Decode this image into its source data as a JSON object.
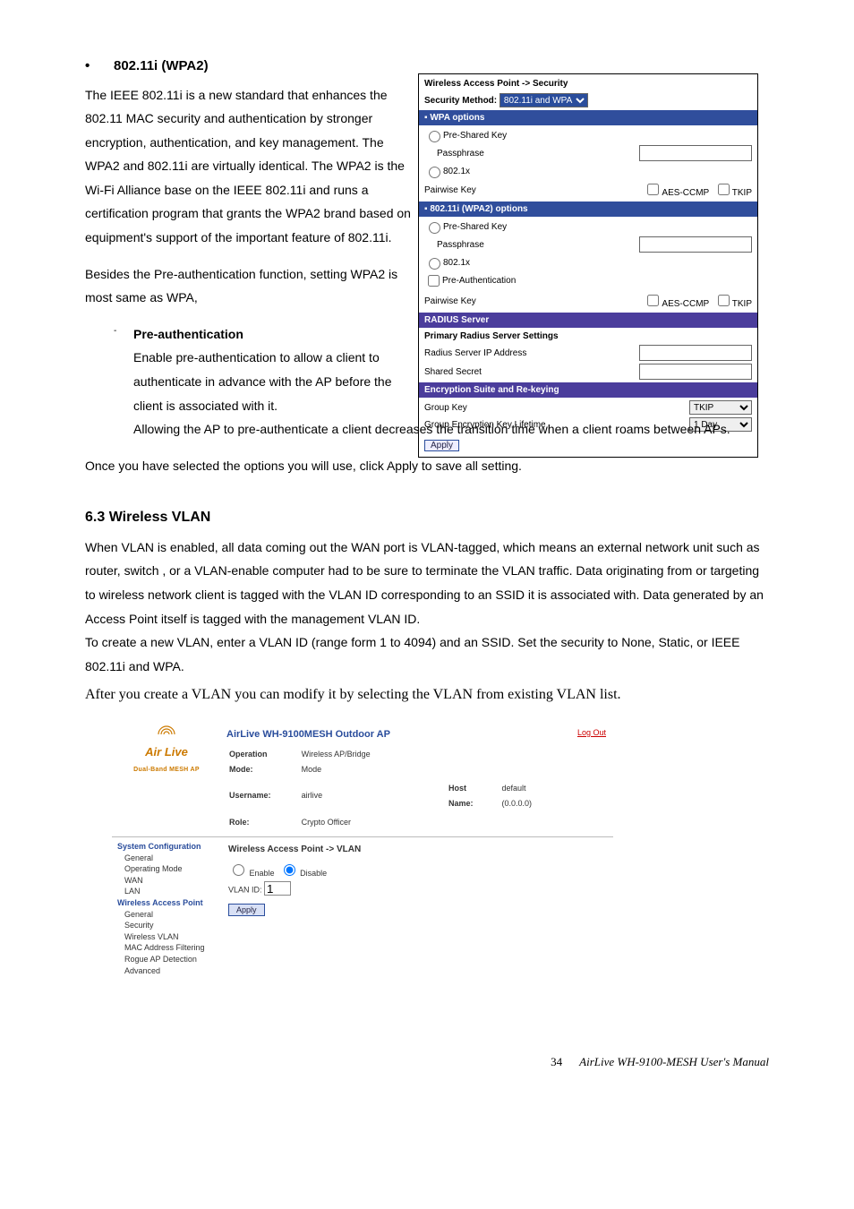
{
  "sec1": {
    "title": "802.11i (WPA2)",
    "p1": "The IEEE 802.11i is a new standard that enhances the 802.11 MAC security and authentication by stronger encryption, authentication, and key management. The WPA2 and 802.11i are virtually identical. The WPA2 is the Wi-Fi Alliance base on the IEEE 802.11i and runs a certification program that grants the WPA2 brand based on equipment's support of the important feature of 802.11i.",
    "p2": "Besides the Pre-authentication function, setting WPA2 is most same as WPA,",
    "sub_title": "Pre-authentication",
    "sub_p1": "Enable pre-authentication to allow a client to authenticate in advance with the AP before the client is associated with it.",
    "sub_p2": "Allowing the AP to pre-authenticate a client decreases the transition time when a client roams between APs.",
    "p3": "Once you have selected the options you will use, click Apply to save all setting."
  },
  "security_panel": {
    "crumb": "Wireless Access Point -> Security",
    "method_label": "Security Method:",
    "method_value": "802.11i and WPA",
    "wpa_hdr": "WPA options",
    "wpa2_hdr": "802.11i (WPA2) options",
    "psk": "Pre-Shared Key",
    "pass": "Passphrase",
    "dot1x": "802.1x",
    "preauth": "Pre-Authentication",
    "pairwise": "Pairwise Key",
    "aes": "AES-CCMP",
    "tkip": "TKIP",
    "radius_hdr": "RADIUS Server",
    "radius_primary": "Primary Radius Server Settings",
    "radius_ip": "Radius Server IP Address",
    "radius_secret": "Shared Secret",
    "enc_hdr": "Encryption Suite and Re-keying",
    "group_key": "Group Key",
    "group_key_val": "TKIP",
    "lifetime": "Group Encryption Key Lifetime",
    "lifetime_val": "1 Day",
    "apply": "Apply"
  },
  "sec2": {
    "heading": "6.3 Wireless VLAN",
    "p1": "When VLAN is enabled, all data coming out the WAN port is VLAN-tagged, which means an external network unit such as router, switch , or a VLAN-enable computer had to be sure to terminate the VLAN traffic. Data originating from or targeting to wireless network client is tagged with the VLAN ID corresponding to an SSID it is associated with. Data generated by an Access Point itself is tagged with the management VLAN ID.",
    "p2": "To create a new VLAN, enter a VLAN ID (range form 1 to 4094) and an SSID. Set the security to None, Static, or IEEE 802.11i and WPA.",
    "p3": "After you create a VLAN you can modify it by selecting the VLAN from existing VLAN list."
  },
  "admin": {
    "product": "AirLive WH-9100MESH Outdoor AP",
    "logo1": "Air Live",
    "logo2": "Dual-Band MESH AP",
    "logout": "Log Out",
    "op_mode_l": "Operation Mode:",
    "op_mode_v": "Wireless AP/Bridge Mode",
    "user_l": "Username:",
    "user_v": "airlive",
    "host_l": "Host Name:",
    "host_v": "default (0.0.0.0)",
    "role_l": "Role:",
    "role_v": "Crypto Officer",
    "nav_grp1": "System Configuration",
    "nav_g1_general": "General",
    "nav_g1_opmode": "Operating Mode",
    "nav_g1_wan": "WAN",
    "nav_g1_lan": "LAN",
    "nav_grp2": "Wireless Access Point",
    "nav_g2_general": "General",
    "nav_g2_security": "Security",
    "nav_g2_vlan": "Wireless VLAN",
    "nav_g2_mac": "MAC Address Filtering",
    "nav_g2_rogue": "Rogue AP Detection",
    "nav_g2_adv": "Advanced",
    "crumb": "Wireless Access Point -> VLAN",
    "enable": "Enable",
    "disable": "Disable",
    "vlan_id_l": "VLAN ID:",
    "vlan_id_v": "1",
    "apply": "Apply"
  },
  "footer": {
    "page": "34",
    "doc": "AirLive WH-9100-MESH User's Manual"
  }
}
